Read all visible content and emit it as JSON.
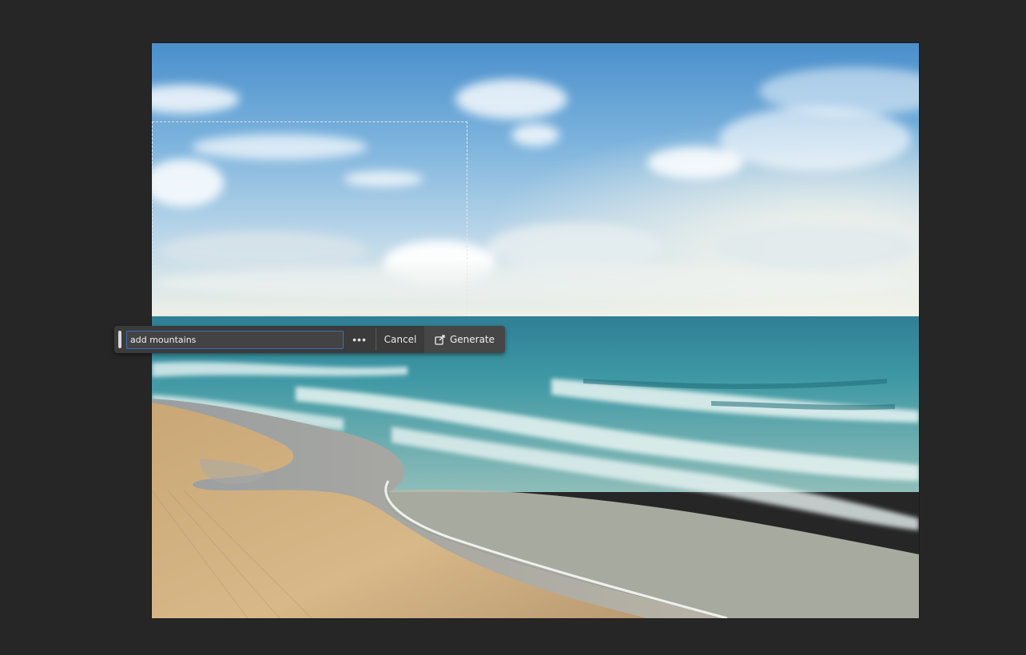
{
  "app": {
    "background_color": "#262626"
  },
  "canvas": {
    "image_subject": "beach-seascape-photo"
  },
  "contextual_bar": {
    "prompt_value": "add mountains",
    "more_icon": "ellipsis-icon",
    "cancel_label": "Cancel",
    "generate_label": "Generate",
    "generate_icon": "generative-fill-icon",
    "input_focus_color": "#3e6fb3"
  }
}
